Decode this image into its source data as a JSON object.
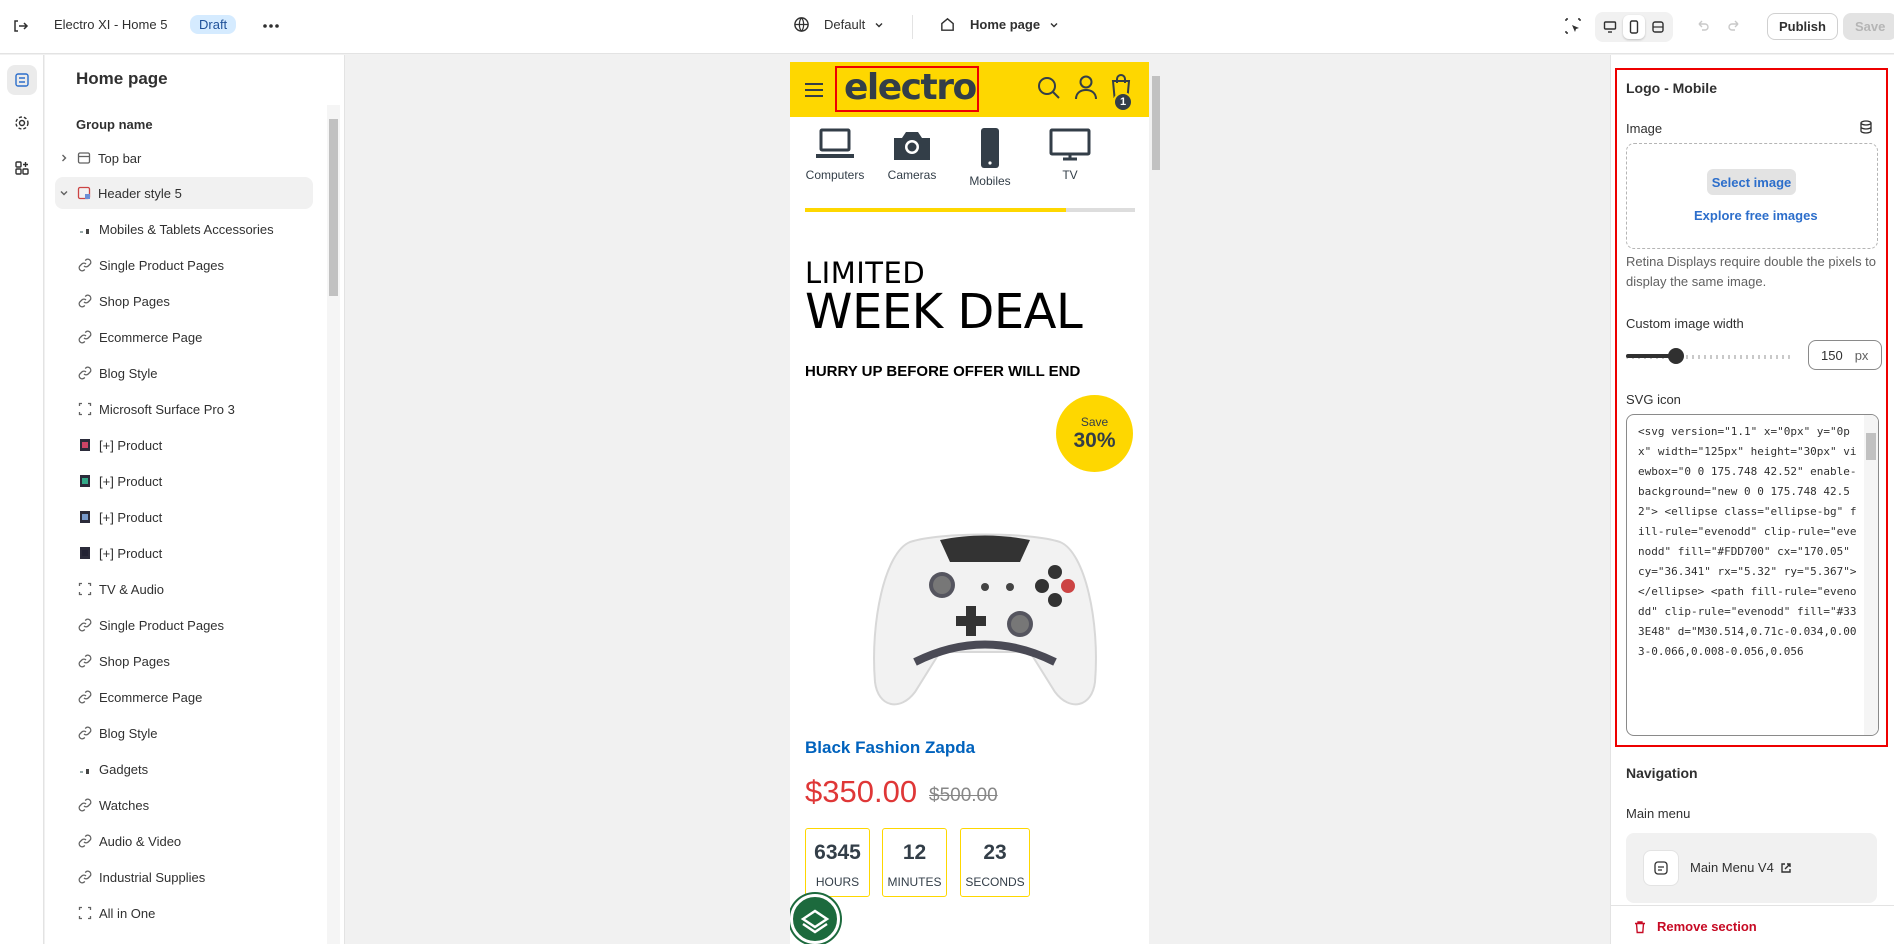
{
  "topbar": {
    "theme_name": "Electro XI - Home 5",
    "status_badge": "Draft",
    "market_select": "Default",
    "page_select": "Home page",
    "publish_label": "Publish",
    "save_label": "Save"
  },
  "sidebar": {
    "title": "Home page",
    "group_name": "Group name",
    "items": [
      {
        "label": "Top bar",
        "icon": "section-icon",
        "level": 0,
        "expand": "chevron-right"
      },
      {
        "label": "Header style 5",
        "icon": "header-section-icon",
        "level": 0,
        "expand": "chevron-down",
        "selected": true
      },
      {
        "label": "Mobiles & Tablets Accessories",
        "icon": "image-thumb-icon",
        "level": 1
      },
      {
        "label": "Single Product Pages",
        "icon": "link-icon",
        "level": 1
      },
      {
        "label": "Shop Pages",
        "icon": "link-icon",
        "level": 1
      },
      {
        "label": "Ecommerce Page",
        "icon": "link-icon",
        "level": 1
      },
      {
        "label": "Blog Style",
        "icon": "link-icon",
        "level": 1
      },
      {
        "label": "Microsoft Surface Pro 3",
        "icon": "dashed-frame-icon",
        "level": 1
      },
      {
        "label": "[+] Product",
        "icon": "product-thumb-icon",
        "level": 1
      },
      {
        "label": "[+] Product",
        "icon": "product-thumb-icon",
        "level": 1
      },
      {
        "label": "[+] Product",
        "icon": "product-thumb-icon",
        "level": 1
      },
      {
        "label": "[+] Product",
        "icon": "product-thumb-icon",
        "level": 1
      },
      {
        "label": "TV & Audio",
        "icon": "dashed-frame-icon",
        "level": 1
      },
      {
        "label": "Single Product Pages",
        "icon": "link-icon",
        "level": 1
      },
      {
        "label": "Shop Pages",
        "icon": "link-icon",
        "level": 1
      },
      {
        "label": "Ecommerce Page",
        "icon": "link-icon",
        "level": 1
      },
      {
        "label": "Blog Style",
        "icon": "link-icon",
        "level": 1
      },
      {
        "label": "Gadgets",
        "icon": "image-thumb-icon",
        "level": 1
      },
      {
        "label": "Watches",
        "icon": "link-icon",
        "level": 1
      },
      {
        "label": "Audio & Video",
        "icon": "link-icon",
        "level": 1
      },
      {
        "label": "Industrial Supplies",
        "icon": "link-icon",
        "level": 1
      },
      {
        "label": "All in One",
        "icon": "dashed-frame-icon",
        "level": 1
      }
    ]
  },
  "preview": {
    "logo_text": "electro",
    "cart_count": "1",
    "categories": [
      {
        "label": "Computers",
        "icon": "laptop-icon"
      },
      {
        "label": "Cameras",
        "icon": "camera-icon"
      },
      {
        "label": "Mobiles",
        "icon": "mobile-icon"
      },
      {
        "label": "TV",
        "icon": "tv-icon"
      }
    ],
    "category_scroll_progress": 0.79,
    "deal_line1": "LIMITED",
    "deal_line2": "WEEK DEAL",
    "deal_subtitle": "HURRY UP BEFORE OFFER WILL END",
    "save_label": "Save",
    "save_percent": "30%",
    "product_name": "Black Fashion Zapda",
    "price": "$350.00",
    "price_old": "$500.00",
    "countdown": [
      {
        "value": "6345",
        "unit": "HOURS"
      },
      {
        "value": "12",
        "unit": "MINUTES"
      },
      {
        "value": "23",
        "unit": "SECONDS"
      }
    ]
  },
  "settings": {
    "section_title": "Logo - Mobile",
    "image_label": "Image",
    "select_image": "Select image",
    "explore_images": "Explore free images",
    "retina_note": "Retina Displays require double the pixels to display the same image.",
    "width_label": "Custom image width",
    "width_value": "150",
    "width_unit": "px",
    "width_slider_fraction": 0.3,
    "svg_label": "SVG icon",
    "svg_code": "<svg version=\"1.1\" x=\"0px\" y=\"0px\" width=\"125px\" height=\"30px\" viewbox=\"0 0 175.748 42.52\" enable-background=\"new 0 0 175.748 42.52\"> <ellipse class=\"ellipse-bg\" fill-rule=\"evenodd\" clip-rule=\"evenodd\" fill=\"#FDD700\" cx=\"170.05\" cy=\"36.341\" rx=\"5.32\" ry=\"5.367\"></ellipse> <path fill-rule=\"evenodd\" clip-rule=\"evenodd\" fill=\"#333E48\" d=\"M30.514,0.71c-0.034,0.003-0.066,0.008-0.056,0.056",
    "navigation_title": "Navigation",
    "main_menu_label": "Main menu",
    "main_menu_value": "Main Menu V4",
    "remove_section": "Remove section"
  },
  "colors": {
    "brand_yellow": "#fed700",
    "brand_dark": "#333e48",
    "link_blue": "#0062bd",
    "price_red": "#df3737",
    "highlight_red": "#ee0000"
  }
}
